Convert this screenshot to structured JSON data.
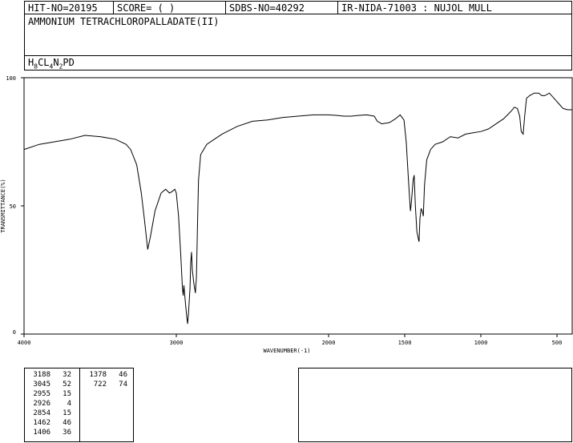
{
  "header": {
    "hit_no": "HIT-NO=20195",
    "score": "SCORE=  (   )",
    "sdbs_no": "SDBS-NO=40292",
    "ir_nida": "IR-NIDA-71003 : NUJOL MULL"
  },
  "compound_name": "AMMONIUM TETRACHLOROPALLADATE(II)",
  "formula": {
    "parts": [
      {
        "t": "H",
        "sub": false
      },
      {
        "t": "8",
        "sub": true
      },
      {
        "t": "CL",
        "sub": false
      },
      {
        "t": "4",
        "sub": true
      },
      {
        "t": "N",
        "sub": false
      },
      {
        "t": "2",
        "sub": true
      },
      {
        "t": "PD",
        "sub": false
      }
    ]
  },
  "chart_data": {
    "type": "line",
    "xlabel": "WAVENUMBER(-1)",
    "ylabel": "TRANSMITTANCE(%)",
    "x_reversed": true,
    "xlim": [
      4000,
      400
    ],
    "ylim": [
      0,
      100
    ],
    "xticks": [
      4000,
      3000,
      2000,
      1500,
      1000,
      500
    ],
    "yticks": [
      0,
      50,
      100
    ],
    "series": [
      {
        "color": "#000000",
        "points": [
          [
            4000,
            72
          ],
          [
            3900,
            74
          ],
          [
            3800,
            75
          ],
          [
            3700,
            76
          ],
          [
            3600,
            77.5
          ],
          [
            3500,
            77
          ],
          [
            3400,
            76
          ],
          [
            3330,
            74
          ],
          [
            3300,
            72
          ],
          [
            3260,
            66
          ],
          [
            3230,
            55
          ],
          [
            3210,
            45
          ],
          [
            3188,
            33
          ],
          [
            3170,
            38
          ],
          [
            3140,
            48
          ],
          [
            3100,
            55
          ],
          [
            3070,
            56.5
          ],
          [
            3045,
            55
          ],
          [
            3030,
            55.5
          ],
          [
            3010,
            56.5
          ],
          [
            3000,
            55
          ],
          [
            2985,
            46
          ],
          [
            2970,
            30
          ],
          [
            2960,
            18
          ],
          [
            2955,
            15
          ],
          [
            2950,
            19
          ],
          [
            2940,
            12
          ],
          [
            2930,
            6
          ],
          [
            2926,
            4
          ],
          [
            2920,
            8
          ],
          [
            2910,
            18
          ],
          [
            2905,
            28
          ],
          [
            2900,
            32
          ],
          [
            2895,
            25
          ],
          [
            2885,
            20
          ],
          [
            2875,
            16
          ],
          [
            2868,
            22
          ],
          [
            2860,
            45
          ],
          [
            2854,
            60
          ],
          [
            2840,
            70
          ],
          [
            2800,
            74
          ],
          [
            2750,
            76
          ],
          [
            2700,
            78
          ],
          [
            2600,
            81
          ],
          [
            2500,
            83
          ],
          [
            2400,
            83.5
          ],
          [
            2300,
            84.5
          ],
          [
            2200,
            85
          ],
          [
            2100,
            85.5
          ],
          [
            2000,
            85.5
          ],
          [
            1950,
            85.3
          ],
          [
            1900,
            85
          ],
          [
            1850,
            85
          ],
          [
            1800,
            85.3
          ],
          [
            1750,
            85.5
          ],
          [
            1700,
            85
          ],
          [
            1680,
            83
          ],
          [
            1650,
            82
          ],
          [
            1600,
            82.5
          ],
          [
            1560,
            84
          ],
          [
            1530,
            85.5
          ],
          [
            1505,
            83.5
          ],
          [
            1490,
            75
          ],
          [
            1475,
            60
          ],
          [
            1465,
            50
          ],
          [
            1462,
            48
          ],
          [
            1455,
            52
          ],
          [
            1445,
            60
          ],
          [
            1438,
            62
          ],
          [
            1430,
            50
          ],
          [
            1420,
            40
          ],
          [
            1410,
            37
          ],
          [
            1406,
            36
          ],
          [
            1400,
            45
          ],
          [
            1392,
            49
          ],
          [
            1385,
            48
          ],
          [
            1378,
            46
          ],
          [
            1370,
            58
          ],
          [
            1355,
            68
          ],
          [
            1330,
            72
          ],
          [
            1300,
            74
          ],
          [
            1250,
            75
          ],
          [
            1200,
            77
          ],
          [
            1150,
            76.5
          ],
          [
            1100,
            78
          ],
          [
            1050,
            78.5
          ],
          [
            1000,
            79
          ],
          [
            950,
            80
          ],
          [
            900,
            82
          ],
          [
            850,
            84
          ],
          [
            800,
            87
          ],
          [
            780,
            88.5
          ],
          [
            760,
            88
          ],
          [
            745,
            85
          ],
          [
            735,
            79
          ],
          [
            722,
            78
          ],
          [
            712,
            85
          ],
          [
            700,
            92
          ],
          [
            680,
            93
          ],
          [
            650,
            94
          ],
          [
            620,
            94
          ],
          [
            600,
            93
          ],
          [
            580,
            93
          ],
          [
            550,
            94
          ],
          [
            520,
            92
          ],
          [
            490,
            90
          ],
          [
            460,
            88
          ],
          [
            430,
            87.5
          ],
          [
            400,
            87.5
          ]
        ]
      }
    ]
  },
  "peaks": {
    "col1": [
      [
        "3188",
        "32"
      ],
      [
        "3045",
        "52"
      ],
      [
        "2955",
        "15"
      ],
      [
        "2926",
        "4"
      ],
      [
        "2854",
        "15"
      ],
      [
        "1462",
        "46"
      ],
      [
        "1406",
        "36"
      ]
    ],
    "col2": [
      [
        "1378",
        "46"
      ],
      [
        "722",
        "74"
      ]
    ]
  }
}
